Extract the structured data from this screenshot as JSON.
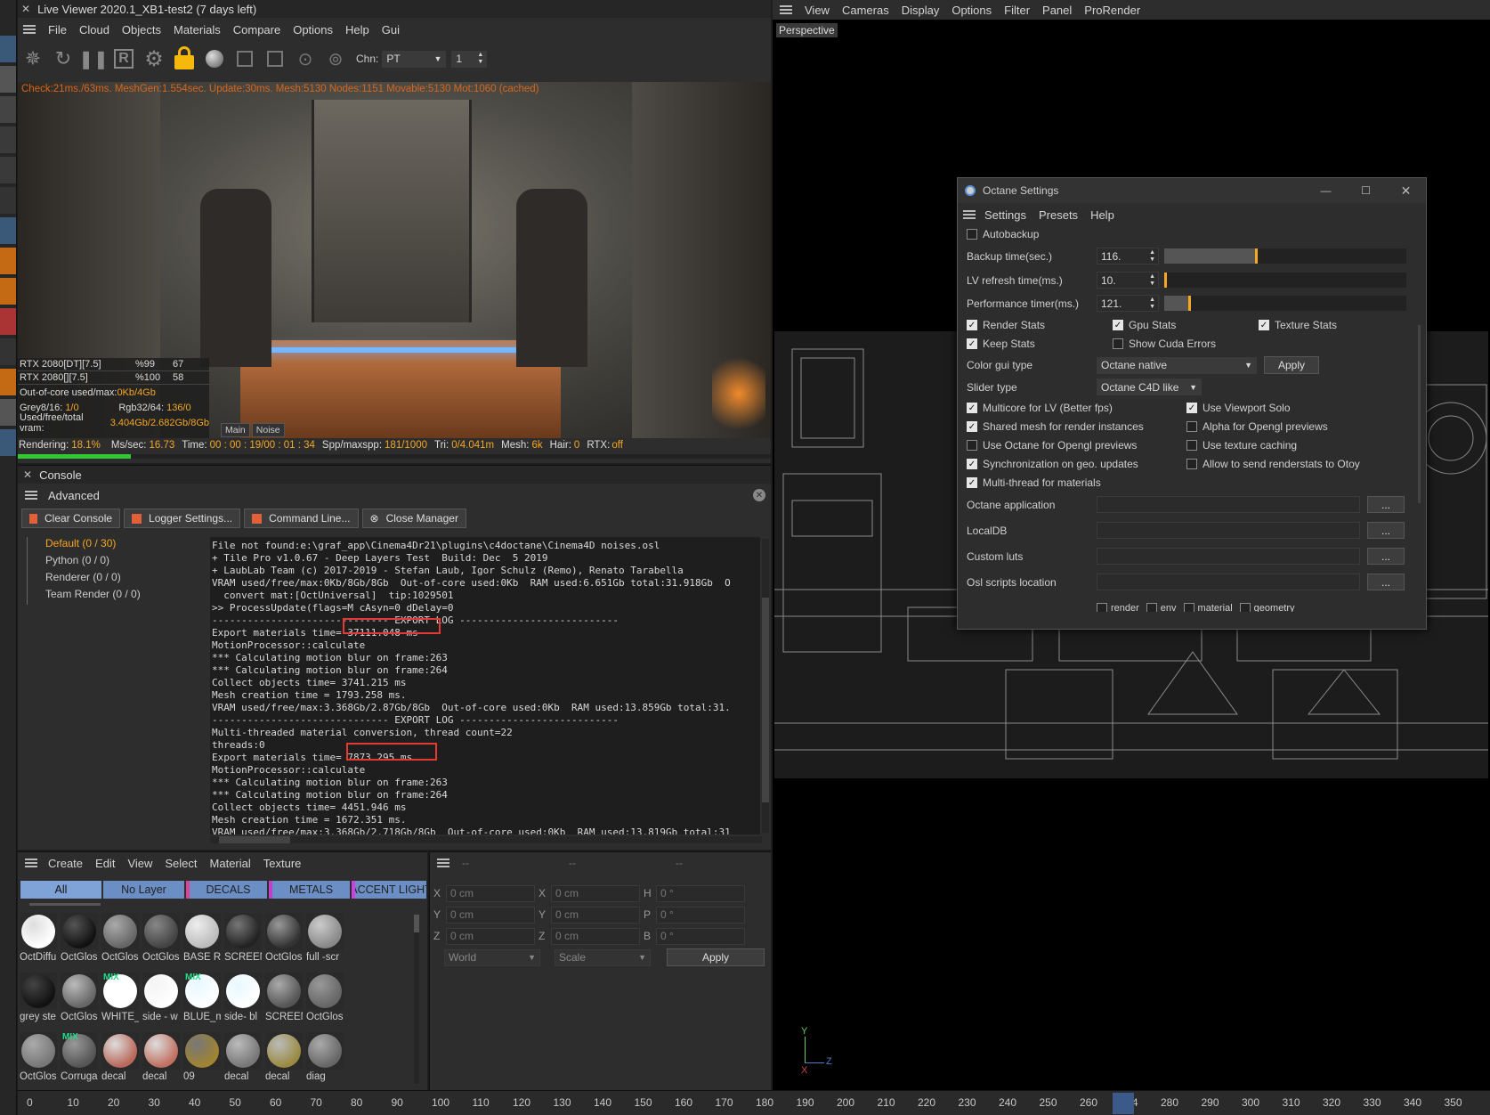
{
  "lv": {
    "title": "Live Viewer 2020.1_XB1-test2 (7 days left)",
    "menu": [
      "File",
      "Cloud",
      "Objects",
      "Materials",
      "Compare",
      "Options",
      "Help",
      "Gui"
    ],
    "chn_label": "Chn:",
    "chn_value": "PT",
    "chn_num": "1",
    "overlay": "Check:21ms./63ms. MeshGen:1.554sec. Update:30ms. Mesh:5130 Nodes:1151 Movable:5130 Mot:1060 (cached)",
    "gpus": [
      {
        "name": "RTX 2080[DT][7.5]",
        "pct": "%99",
        "temp": "67"
      },
      {
        "name": "RTX 2080[][7.5]",
        "pct": "%100",
        "temp": "58"
      }
    ],
    "ooc": "Out-of-core used/max:",
    "ooc_val": "0Kb/4Gb",
    "grey": "Grey8/16:",
    "grey_val": "1/0",
    "rgb": "Rgb32/64:",
    "rgb_val": "136/0",
    "vram": "Used/free/total vram:",
    "vram_val": "3.404Gb/2.682Gb/8Gb",
    "tab_main": "Main",
    "tab_noise": "Noise",
    "status": {
      "rendering": "Rendering:",
      "rendering_val": "18.1%",
      "mssec": "Ms/sec:",
      "mssec_val": "16.73",
      "time": "Time:",
      "time_val": "00 : 00 : 19/00 : 01 : 34",
      "spp": "Spp/maxspp:",
      "spp_val": "181/1000",
      "tri": "Tri:",
      "tri_val": "0/4.041m",
      "mesh": "Mesh:",
      "mesh_val": "6k",
      "hair": "Hair:",
      "hair_val": "0",
      "rtx": "RTX:",
      "rtx_val": "off"
    },
    "progress": 0.181
  },
  "console": {
    "title": "Console",
    "mode": "Advanced",
    "buttons": [
      "Clear Console",
      "Logger Settings...",
      "Command Line...",
      "Close Manager"
    ],
    "tree": [
      "Default (0 / 30)",
      "Python (0 / 0)",
      "Renderer (0 / 0)",
      "Team Render  (0 / 0)"
    ],
    "lines": [
      "File not found:e:\\graf_app\\Cinema4Dr21\\plugins\\c4doctane\\Cinema4D noises.osl",
      "+ Tile Pro v1.0.67 - Deep Layers Test  Build: Dec  5 2019",
      "+ LaubLab Team (c) 2017-2019 - Stefan Laub, Igor Schulz (Remo), Renato Tarabella",
      "VRAM used/free/max:0Kb/8Gb/8Gb  Out-of-core used:0Kb  RAM used:6.651Gb total:31.918Gb  O",
      "  convert mat:[OctUniversal]  tip:1029501",
      ">> ProcessUpdate(flags=M cAsyn=0 dDelay=0",
      "------------------------------ EXPORT LOG ---------------------------",
      "Export materials time= 37111.048 ms",
      "MotionProcessor::calculate",
      "*** Calculating motion blur on frame:263",
      "*** Calculating motion blur on frame:264",
      "Collect objects time= 3741.215 ms",
      "Mesh creation time = 1793.258 ms.",
      "VRAM used/free/max:3.368Gb/2.87Gb/8Gb  Out-of-core used:0Kb  RAM used:13.859Gb total:31.",
      "------------------------------ EXPORT LOG ---------------------------",
      "Multi-threaded material conversion, thread count=22",
      "threads:0",
      "Export materials time= 7873.295 ms",
      "MotionProcessor::calculate",
      "*** Calculating motion blur on frame:263",
      "*** Calculating motion blur on frame:264",
      "Collect objects time= 4451.946 ms",
      "Mesh creation time = 1672.351 ms.",
      "VRAM used/free/max:3.368Gb/2.718Gb/8Gb  Out-of-core used:0Kb  RAM used:13.819Gb total:31"
    ]
  },
  "matmgr": {
    "menu": [
      "Create",
      "Edit",
      "View",
      "Select",
      "Material",
      "Texture"
    ],
    "layers": [
      "All",
      "No Layer",
      "DECALS",
      "METALS",
      "ACCENT LIGHT"
    ],
    "items": [
      "OctDiffu",
      "OctGlos",
      "OctGlos",
      "OctGlos",
      "BASE R(",
      "SCREEN",
      "OctGlos",
      "full -scr",
      "grey ste",
      "OctGlos",
      "WHITE_",
      "side - w",
      "BLUE_m",
      "side- bl",
      "SCREEN",
      "OctGlos",
      "OctGlos",
      "Corruga",
      "decal",
      "decal",
      "09",
      "decal",
      "decal",
      "diag"
    ],
    "mix": "MIX"
  },
  "coords": {
    "dash": "--",
    "rows": [
      {
        "a": "X",
        "av": "0 cm",
        "b": "X",
        "bv": "0 cm",
        "c": "H",
        "cv": "0 °"
      },
      {
        "a": "Y",
        "av": "0 cm",
        "b": "Y",
        "bv": "0 cm",
        "c": "P",
        "cv": "0 °"
      },
      {
        "a": "Z",
        "av": "0 cm",
        "b": "Z",
        "bv": "0 cm",
        "c": "B",
        "cv": "0 °"
      }
    ],
    "world": "World",
    "scale": "Scale",
    "apply": "Apply"
  },
  "viewport": {
    "menu": [
      "View",
      "Cameras",
      "Display",
      "Options",
      "Filter",
      "Panel",
      "ProRender"
    ],
    "label": "Perspective",
    "axis_y": "Y",
    "axis_z": "Z",
    "axis_x": "X"
  },
  "timeline": {
    "ticks": [
      "0",
      "10",
      "20",
      "30",
      "40",
      "50",
      "60",
      "70",
      "80",
      "90",
      "100",
      "110",
      "120",
      "130",
      "140",
      "150",
      "160",
      "170",
      "180",
      "190",
      "200",
      "210",
      "220",
      "230",
      "240",
      "250",
      "260",
      "264",
      "280",
      "290",
      "300",
      "310",
      "320",
      "330",
      "340",
      "350"
    ]
  },
  "octane": {
    "title": "Octane Settings",
    "menu": [
      "Settings",
      "Presets",
      "Help"
    ],
    "autobackup": "Autobackup",
    "backup": "Backup time(sec.)",
    "backup_val": "116.",
    "lvref": "LV refresh time(ms.)",
    "lvref_val": "10.",
    "perf": "Performance timer(ms.)",
    "perf_val": "121.",
    "render_stats": "Render Stats",
    "gpu_stats": "Gpu Stats",
    "texture_stats": "Texture Stats",
    "keep_stats": "Keep Stats",
    "cuda": "Show Cuda Errors",
    "color_gui": "Color gui type",
    "color_gui_val": "Octane native",
    "apply": "Apply",
    "slider": "Slider type",
    "slider_val": "Octane C4D like",
    "c1": "Multicore for LV (Better fps)",
    "c2": "Use Viewport Solo",
    "c3": "Shared mesh for render instances",
    "c4": "Alpha for Opengl previews",
    "c5": "Use Octane for Opengl previews",
    "c6": "Use texture caching",
    "c7": "Synchronization on geo. updates",
    "c8": "Allow to send renderstats to Otoy",
    "c9": "Multi-thread for materials",
    "app": "Octane application",
    "localdb": "LocalDB",
    "luts": "Custom luts",
    "osl": "Osl scripts location",
    "dots": "...",
    "bottom": [
      "render",
      "env",
      "material",
      "geometry"
    ]
  },
  "colors": {
    "accent": "#f5a623",
    "panel": "#2b2b2b",
    "highlight": "#e53935",
    "active_tab": "#7fa3d6"
  }
}
